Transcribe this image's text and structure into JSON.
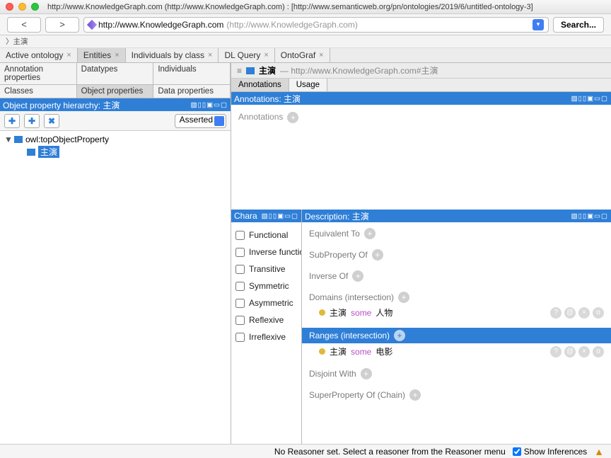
{
  "titlebar": {
    "title": "http://www.KnowledgeGraph.com (http://www.KnowledgeGraph.com)  : [http://www.semanticweb.org/pn/ontologies/2019/6/untitled-ontology-3]"
  },
  "toolbar": {
    "back": "<",
    "fwd": ">",
    "url_main": "http://www.KnowledgeGraph.com",
    "url_faded": "(http://www.KnowledgeGraph.com)",
    "search_label": "Search..."
  },
  "breadcrumb": {
    "text": "〉主演"
  },
  "view_tabs": [
    {
      "label": "Active ontology",
      "active": false
    },
    {
      "label": "Entities",
      "active": true
    },
    {
      "label": "Individuals by class",
      "active": false
    },
    {
      "label": "DL Query",
      "active": false
    },
    {
      "label": "OntoGraf",
      "active": false
    }
  ],
  "left_tabs_row1": [
    "Annotation properties",
    "Datatypes",
    "Individuals"
  ],
  "left_tabs_row2": [
    "Classes",
    "Object properties",
    "Data properties"
  ],
  "left_active": "Object properties",
  "hierarchy_panel": {
    "title": "Object property hierarchy: 主演",
    "icons": "▧▯▯▣▭▢"
  },
  "tree_toolbar": {
    "asserted": "Asserted"
  },
  "tree": {
    "root": "owl:topObjectProperty",
    "selected": "主演"
  },
  "object_header": {
    "name": "主演",
    "uri": "— http://www.KnowledgeGraph.com#主演"
  },
  "sub_tabs": [
    "Annotations",
    "Usage"
  ],
  "anno_panel": {
    "title": "Annotations: 主演",
    "icons": "▧▯▯▣▭▢",
    "empty_label": "Annotations"
  },
  "chara_panel": {
    "title": "Chara",
    "icons": "▧▯▯▣▭▢",
    "checks": [
      "Functional",
      "Inverse functional",
      "Transitive",
      "Symmetric",
      "Asymmetric",
      "Reflexive",
      "Irreflexive"
    ]
  },
  "desc_panel": {
    "title": "Description: 主演",
    "icons": "▧▯▯▣▭▢",
    "sections": {
      "equivalent": "Equivalent To",
      "subprop": "SubProperty Of",
      "inverse": "Inverse Of",
      "domains": "Domains (intersection)",
      "domains_expr": {
        "t1": "主演",
        "kw": "some",
        "t2": "人物"
      },
      "ranges": "Ranges (intersection)",
      "ranges_expr": {
        "t1": "主演",
        "kw": "some",
        "t2": "电影"
      },
      "disjoint": "Disjoint With",
      "superchain": "SuperProperty Of (Chain)"
    }
  },
  "status": {
    "msg": "No Reasoner set. Select a reasoner from the Reasoner menu",
    "show_inf": "Show Inferences"
  }
}
